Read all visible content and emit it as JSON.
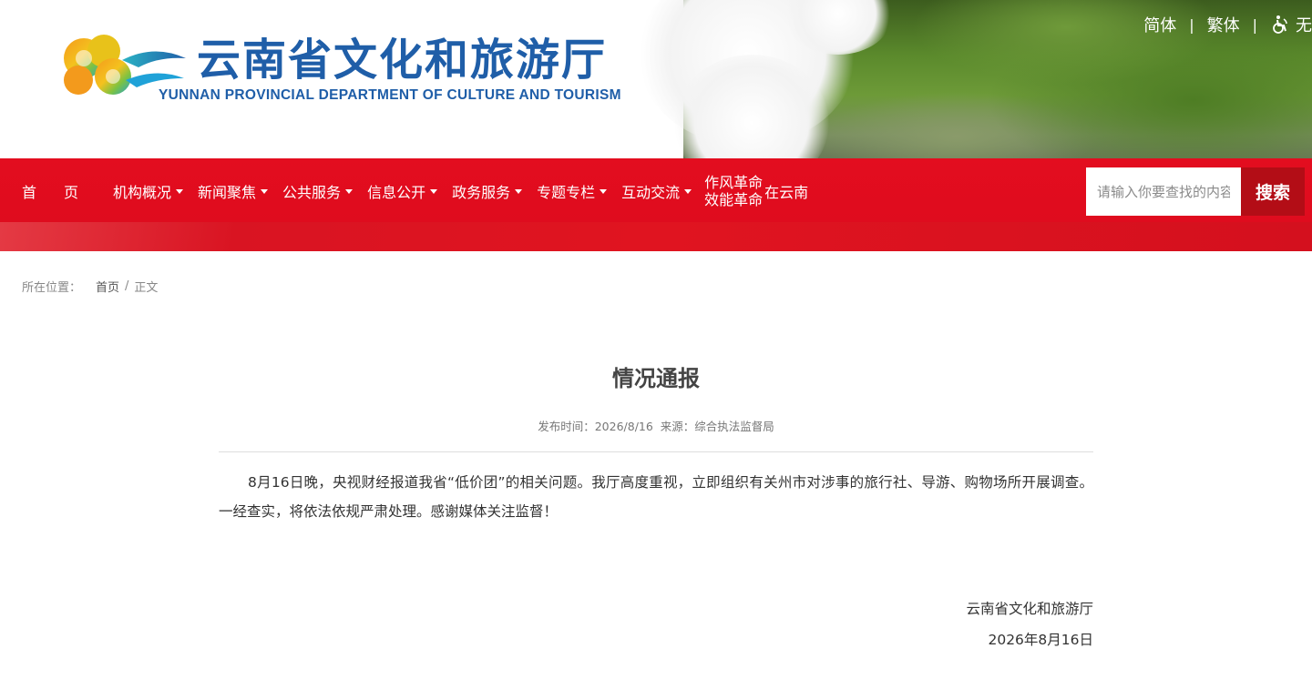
{
  "header": {
    "logo_cn": "云南省文化和旅游厅",
    "logo_en": "YUNNAN PROVINCIAL DEPARTMENT OF CULTURE AND TOURISM",
    "lang_simplified": "简体",
    "lang_traditional": "繁体",
    "separator": "|",
    "accessibility_label": "无",
    "brand_color": "#1f5ea8"
  },
  "nav": {
    "bg_color": "#e30d1f",
    "home": "首页",
    "items": [
      {
        "label": "机构概况"
      },
      {
        "label": "新闻聚焦"
      },
      {
        "label": "公共服务"
      },
      {
        "label": "信息公开"
      },
      {
        "label": "政务服务"
      },
      {
        "label": "专题专栏"
      },
      {
        "label": "互动交流"
      }
    ],
    "special_line1": "作风革命",
    "special_line2": "效能革命",
    "special_tail": "在云南"
  },
  "search": {
    "placeholder": "请输入你要查找的内容",
    "button_label": "搜索"
  },
  "breadcrumb": {
    "prefix": "所在位置：",
    "home": "首页",
    "separator": "/",
    "current": "正文"
  },
  "article": {
    "title": "情况通报",
    "meta": "发布时间：2026/8/16  来源：综合执法监督局",
    "body": "8月16日晚，央视财经报道我省“低价团”的相关问题。我厅高度重视，立即组织有关州市对涉事的旅行社、导游、购物场所开展调查。一经查实，将依法依规严肃处理。感谢媒体关注监督！",
    "signature": "云南省文化和旅游厅",
    "date": "2026年8月16日"
  }
}
